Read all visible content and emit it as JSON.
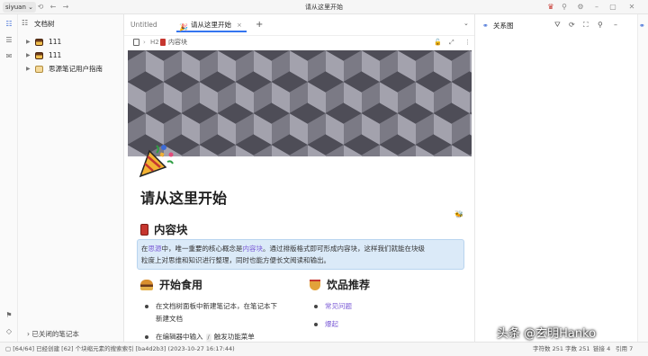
{
  "topbar": {
    "workspace": "siyuan",
    "title": "请从这里开始"
  },
  "tree": {
    "title": "文档树",
    "items": [
      {
        "label": "111",
        "icon": "notebook-cake-icon"
      },
      {
        "label": "111",
        "icon": "notebook-cake-icon"
      },
      {
        "label": "思源笔记用户指南",
        "icon": "notebook-book-icon"
      }
    ],
    "closed": "已关闭的笔记本"
  },
  "tabs": [
    {
      "label": "Untitled"
    },
    {
      "label": "请从这里开始",
      "active": true
    }
  ],
  "breadcrumb": {
    "heading_level": "H2",
    "label": "内容块"
  },
  "doc": {
    "title": "请从这里开始",
    "heading_block": "内容块",
    "callout": {
      "p1": "在",
      "link1": "思源",
      "p2": "中，唯一重要的核心概念是",
      "link2": "内容块",
      "p3": "。通过排版格式即可形成内容块，这样我们就能在块级",
      "p4": "粒度上对思维和知识进行整理，同时也能方便长文阅读和输出。"
    },
    "left_heading": "开始食用",
    "left_items": [
      {
        "line1": "在文档树面板中新建笔记本，在笔记本下",
        "line2": "新建文档"
      },
      {
        "pre": "在编辑器中输入",
        "key": "/",
        "post": "触发功能菜单"
      }
    ],
    "right_heading": "饮品推荐",
    "right_items": [
      "常见问题",
      "爆起"
    ]
  },
  "right_panel": {
    "title": "关系图"
  },
  "status": {
    "message": "[64/64] 已经创建 [62] 个块缩元素的搜索索引 [ba4d2b3] (2023-10-27 16:17:44)",
    "chars": "字符数 251",
    "words": "字数 251",
    "links": "链接 4",
    "refs": "引用 7"
  },
  "watermark": "头条 @玄明Hanko",
  "colors": {
    "accent": "#3575f0",
    "link": "#7b5bd6",
    "callout_bg": "#dbeaf8"
  }
}
